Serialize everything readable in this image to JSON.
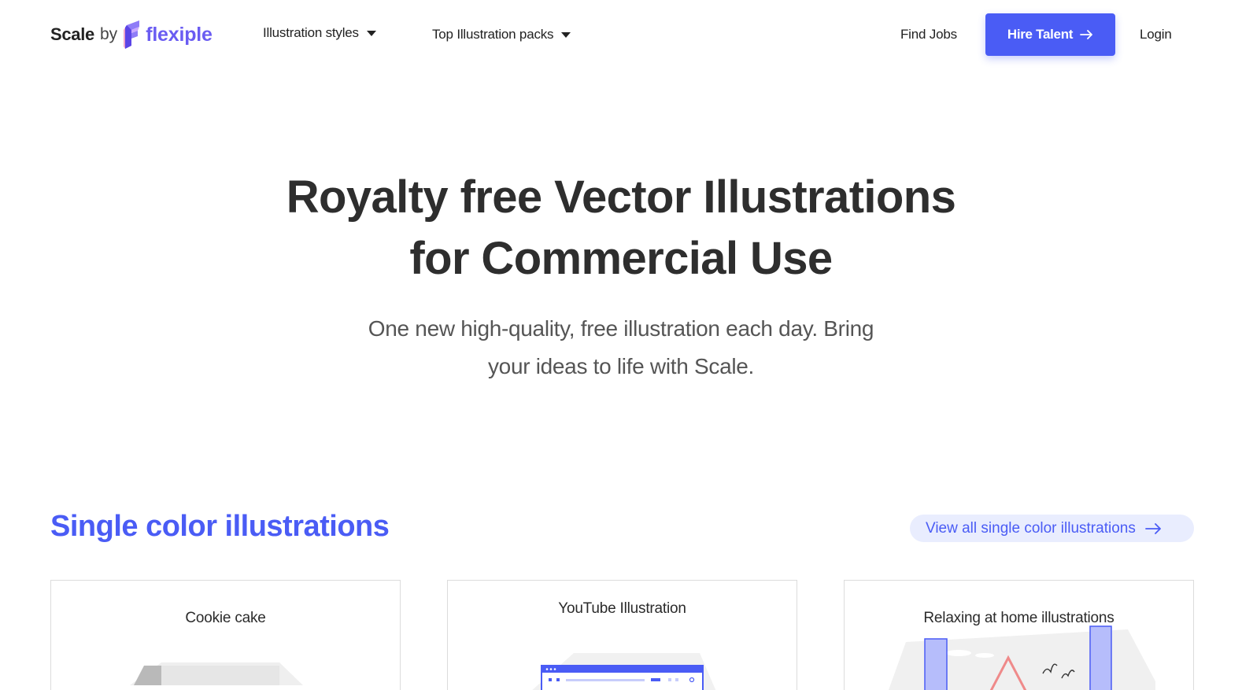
{
  "brand": {
    "scale": "Scale",
    "by": "by",
    "name": "flexiple"
  },
  "nav": {
    "illustration_styles": "Illustration styles",
    "top_packs": "Top Illustration packs",
    "find_jobs": "Find Jobs",
    "hire_talent": "Hire Talent",
    "login": "Login"
  },
  "hero": {
    "title_line1": "Royalty free Vector Illustrations",
    "title_line2": "for Commercial Use",
    "subtitle_line1": "One new high-quality, free illustration each day. Bring",
    "subtitle_line2": "your ideas to life with Scale."
  },
  "section": {
    "title": "Single color illustrations",
    "view_all": "View all single color illustrations"
  },
  "cards": [
    {
      "label": "Cookie cake"
    },
    {
      "label": "YouTube Illustration"
    },
    {
      "label": "Relaxing at home illustrations"
    }
  ],
  "colors": {
    "accent": "#4a5cf5",
    "accent_light": "#e9edfe",
    "heading": "#2e2e2e",
    "body_text": "#555555",
    "logo_purple": "#6a5cf2",
    "card_border": "#dcdcdc"
  },
  "icons": {
    "dropdown": "caret-down-icon",
    "arrow": "arrow-right-icon",
    "logo": "flexiple-logo-icon"
  }
}
